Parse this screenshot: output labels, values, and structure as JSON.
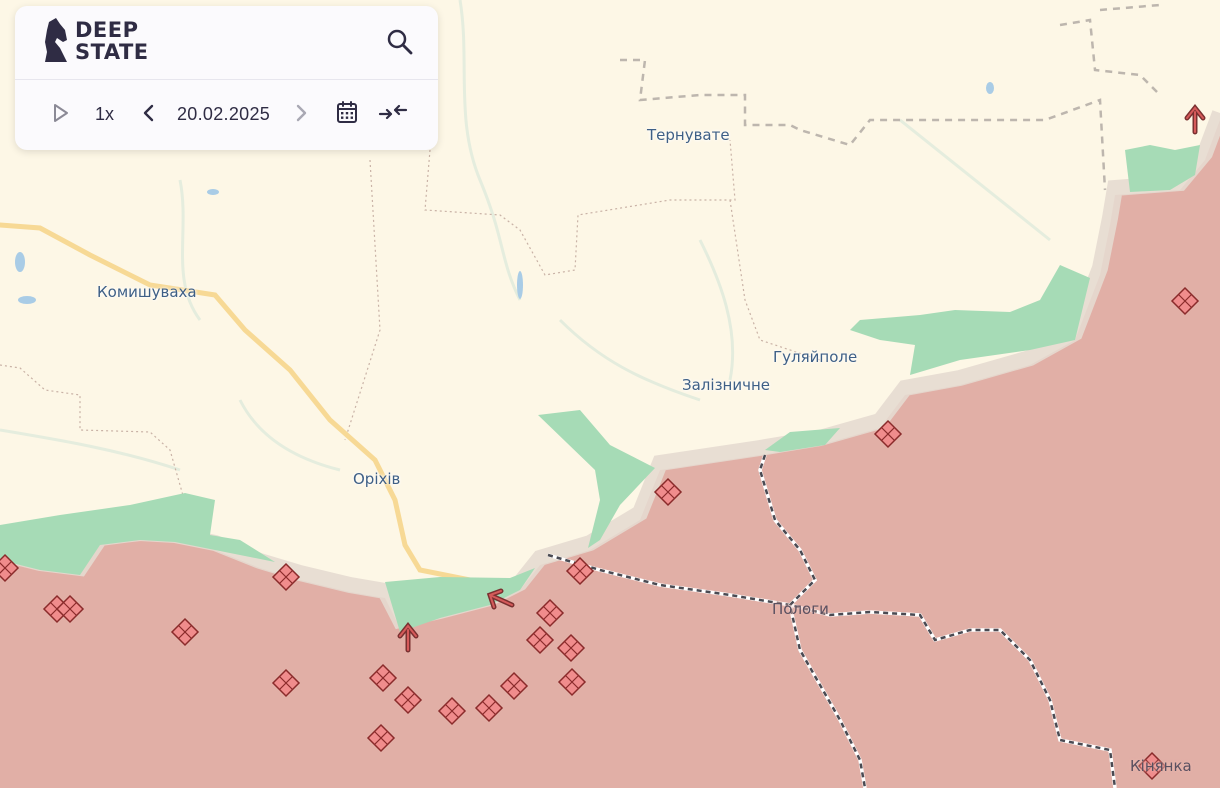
{
  "app": {
    "logo_line1": "DEEP",
    "logo_line2": "STATE"
  },
  "toolbar": {
    "speed": "1x",
    "date": "20.02.2025",
    "icons": [
      "play-icon",
      "chevron-left-icon",
      "chevron-right-icon",
      "calendar-icon",
      "collapse-arrows-icon",
      "search-icon"
    ]
  },
  "map": {
    "colors": {
      "free_territory": "#fdf7e6",
      "occupied": "#e1afa6",
      "liberated": "#a6dbb6",
      "gray_zone": "#e6dad0",
      "road": "#f7d995",
      "border_line": "#4a4a52",
      "marker_fill": "#f08c8c",
      "marker_stroke": "#8a2b2b"
    },
    "places": [
      {
        "name": "Тернувате",
        "side": "free"
      },
      {
        "name": "Комишуваха",
        "side": "free"
      },
      {
        "name": "Гуляйполе",
        "side": "free"
      },
      {
        "name": "Залізничне",
        "side": "free"
      },
      {
        "name": "Оріхів",
        "side": "free"
      },
      {
        "name": "Пологи",
        "side": "occupied"
      },
      {
        "name": "Кінянка",
        "side": "occupied"
      }
    ]
  }
}
